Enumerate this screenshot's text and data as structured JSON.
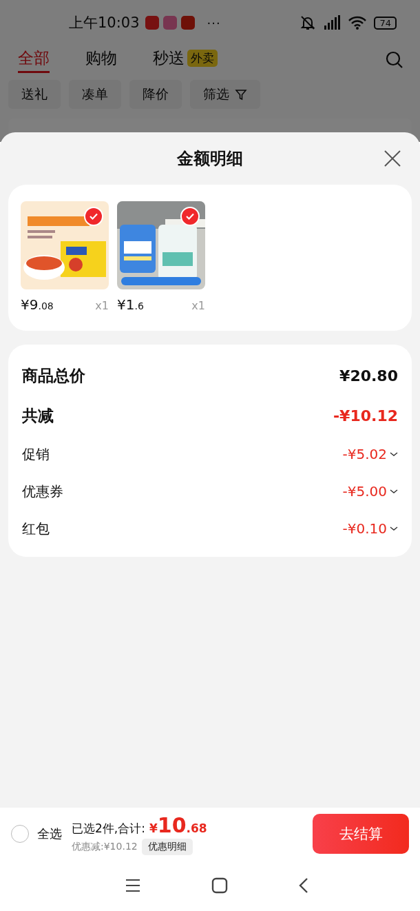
{
  "status_bar": {
    "time": "上午10:03",
    "more": "···",
    "battery": "74"
  },
  "tabs": [
    {
      "label": "全部",
      "selected": true
    },
    {
      "label": "购物",
      "selected": false
    },
    {
      "label": "秒送",
      "selected": false,
      "badge": "外卖"
    }
  ],
  "chips": [
    {
      "label": "送礼",
      "kind": "plain"
    },
    {
      "label": "凑单",
      "kind": "plain"
    },
    {
      "label": "降价",
      "kind": "plain"
    },
    {
      "label": "筛选",
      "kind": "filter"
    }
  ],
  "sheet": {
    "title": "金额明细",
    "products": [
      {
        "kind": "picture",
        "selected": true,
        "price": "¥9",
        "cents": ".08",
        "qty": "x1"
      },
      {
        "kind": "picture",
        "selected": true,
        "price": "¥1",
        "cents": ".6",
        "qty": "x1"
      }
    ],
    "rows": [
      {
        "kind": "total",
        "label": "商品总价",
        "value": "¥20.80"
      },
      {
        "kind": "reduction",
        "label": "共减",
        "value": "-¥10.12"
      },
      {
        "kind": "detail",
        "label": "促销",
        "value": "-¥5.02"
      },
      {
        "kind": "detail",
        "label": "优惠券",
        "value": "-¥5.00"
      },
      {
        "kind": "detail",
        "label": "红包",
        "value": "-¥0.10"
      }
    ]
  },
  "checkout": {
    "select_all": {
      "label": "全选",
      "checked": false
    },
    "summary": "已选2件,合计:",
    "currency": "¥",
    "amount": "10",
    "cents": ".68",
    "discount": "优惠减:¥10.12",
    "detail_button": "优惠明细",
    "checkout_button": "去结算"
  }
}
